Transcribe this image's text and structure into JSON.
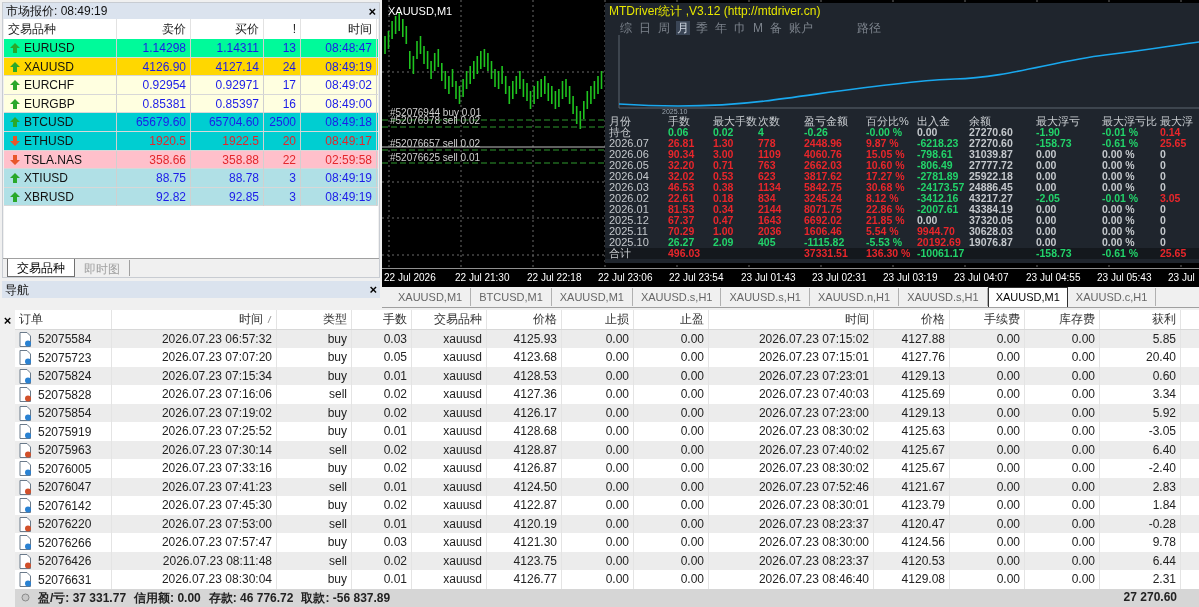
{
  "market_watch": {
    "title": "市场报价: 08:49:19",
    "close": "×",
    "columns": [
      "交易品种",
      "卖价",
      "买价",
      "!",
      "时间"
    ],
    "rows": [
      {
        "symbol": "EURUSD",
        "bid": "1.14298",
        "ask": "1.14311",
        "spread": "13",
        "time": "08:48:47",
        "rising": true,
        "color": "#00fa9a"
      },
      {
        "symbol": "XAUUSD",
        "bid": "4126.90",
        "ask": "4127.14",
        "spread": "24",
        "time": "08:49:19",
        "rising": true,
        "color": "#ffd700"
      },
      {
        "symbol": "EURCHF",
        "bid": "0.92954",
        "ask": "0.92971",
        "spread": "17",
        "time": "08:49:02",
        "rising": true,
        "color": "#ffffe0"
      },
      {
        "symbol": "EURGBP",
        "bid": "0.85381",
        "ask": "0.85397",
        "spread": "16",
        "time": "08:49:00",
        "rising": true,
        "color": "#ffffe0"
      },
      {
        "symbol": "BTCUSD",
        "bid": "65679.60",
        "ask": "65704.60",
        "spread": "2500",
        "time": "08:49:18",
        "rising": true,
        "color": "#00ced1"
      },
      {
        "symbol": "ETHUSD",
        "bid": "1920.5",
        "ask": "1922.5",
        "spread": "20",
        "time": "08:49:17",
        "rising": false,
        "color": "#00ced1"
      },
      {
        "symbol": "TSLA.NAS",
        "bid": "358.66",
        "ask": "358.88",
        "spread": "22",
        "time": "02:59:58",
        "rising": false,
        "color": "#ffc0cb"
      },
      {
        "symbol": "XTIUSD",
        "bid": "88.75",
        "ask": "88.78",
        "spread": "3",
        "time": "08:49:19",
        "rising": true,
        "color": "#b0e0e6"
      },
      {
        "symbol": "XBRUSD",
        "bid": "92.82",
        "ask": "92.85",
        "spread": "3",
        "time": "08:49:19",
        "rising": true,
        "color": "#b0e0e6"
      }
    ],
    "tabs": [
      {
        "label": "交易品种",
        "selected": true
      },
      {
        "label": "即时图",
        "selected": false
      }
    ]
  },
  "navigator": {
    "title": "导航",
    "close": "×"
  },
  "chart": {
    "title": "XAUUSD,M1",
    "orders": [
      "#52076944 buy 0.01",
      "#52076978 sell 0.02",
      "#52076657 sell 0.02",
      "#52076625 sell 0.01"
    ],
    "time_axis": [
      "22 Jul 2026",
      "22 Jul 21:30",
      "22 Jul 22:18",
      "22 Jul 23:06",
      "22 Jul 23:54",
      "23 Jul 01:43",
      "23 Jul 02:31",
      "23 Jul 03:19",
      "23 Jul 04:07",
      "23 Jul 04:55",
      "23 Jul 05:43",
      "23 Jul"
    ]
  },
  "stats_panel": {
    "title": "MTDriver统计 ,V3.12 (http://mtdriver.cn)",
    "menu": [
      {
        "label": "综",
        "selected": false
      },
      {
        "label": "日",
        "selected": false
      },
      {
        "label": "周",
        "selected": false
      },
      {
        "label": "月",
        "selected": true
      },
      {
        "label": "季",
        "selected": false
      },
      {
        "label": "年",
        "selected": false
      },
      {
        "label": "巾",
        "selected": false
      },
      {
        "label": "M",
        "selected": false
      },
      {
        "label": "备",
        "selected": false
      },
      {
        "label": "账户",
        "selected": false
      }
    ],
    "path_button": "路径",
    "curve_label": "2025.10",
    "columns": [
      "月份",
      "手数",
      "最大手数",
      "次数",
      "盈亏金额",
      "百分比%",
      "出入金",
      "余额",
      "最大浮亏",
      "最大浮亏比",
      "最大浮"
    ],
    "rows": [
      {
        "kind": "period",
        "label": "持仓",
        "lots": {
          "text": "0.06",
          "color": "#22d36a"
        },
        "max_lots": {
          "text": "0.02",
          "color": "#22d36a"
        },
        "count": {
          "text": "4",
          "color": "#22d36a"
        },
        "pnl": {
          "text": "-0.26",
          "color": "#22d36a"
        },
        "percent": {
          "text": "-0.00 %",
          "color": "#22d36a"
        },
        "cash_flow": {
          "text": "0.00",
          "color": "#c4c8cc"
        },
        "balance": {
          "text": "27270.60",
          "color": "#c4c8cc"
        },
        "max_float_loss": {
          "text": "-1.90",
          "color": "#22d36a"
        },
        "max_float_ratio": {
          "text": "-0.01 %",
          "color": "#22d36a"
        },
        "column_11": {
          "text": "0.14",
          "color": "#e8262b"
        }
      },
      {
        "kind": "period",
        "label": "2026.07",
        "lots": {
          "text": "26.81",
          "color": "#e8262b"
        },
        "max_lots": {
          "text": "1.30",
          "color": "#e8262b"
        },
        "count": {
          "text": "778",
          "color": "#e8262b"
        },
        "pnl": {
          "text": "2448.96",
          "color": "#e8262b"
        },
        "percent": {
          "text": "9.87 %",
          "color": "#e8262b"
        },
        "cash_flow": {
          "text": "-6218.23",
          "color": "#22d36a"
        },
        "balance": {
          "text": "27270.60",
          "color": "#c4c8cc"
        },
        "max_float_loss": {
          "text": "-158.73",
          "color": "#22d36a"
        },
        "max_float_ratio": {
          "text": "-0.61 %",
          "color": "#22d36a"
        },
        "column_11": {
          "text": "25.65",
          "color": "#e8262b"
        }
      },
      {
        "kind": "period",
        "label": "2026.06",
        "lots": {
          "text": "90.34",
          "color": "#e8262b"
        },
        "max_lots": {
          "text": "3.00",
          "color": "#e8262b"
        },
        "count": {
          "text": "1109",
          "color": "#e8262b"
        },
        "pnl": {
          "text": "4060.76",
          "color": "#e8262b"
        },
        "percent": {
          "text": "15.05 %",
          "color": "#e8262b"
        },
        "cash_flow": {
          "text": "-798.61",
          "color": "#22d36a"
        },
        "balance": {
          "text": "31039.87",
          "color": "#c4c8cc"
        },
        "max_float_loss": {
          "text": "0.00",
          "color": "#c4c8cc"
        },
        "max_float_ratio": {
          "text": "0.00 %",
          "color": "#c4c8cc"
        },
        "column_11": {
          "text": "0",
          "color": "#c4c8cc"
        }
      },
      {
        "kind": "period",
        "label": "2026.05",
        "lots": {
          "text": "32.20",
          "color": "#e8262b"
        },
        "max_lots": {
          "text": "0.71",
          "color": "#e8262b"
        },
        "count": {
          "text": "763",
          "color": "#e8262b"
        },
        "pnl": {
          "text": "2662.03",
          "color": "#e8262b"
        },
        "percent": {
          "text": "10.60 %",
          "color": "#e8262b"
        },
        "cash_flow": {
          "text": "-806.49",
          "color": "#22d36a"
        },
        "balance": {
          "text": "27777.72",
          "color": "#c4c8cc"
        },
        "max_float_loss": {
          "text": "0.00",
          "color": "#c4c8cc"
        },
        "max_float_ratio": {
          "text": "0.00 %",
          "color": "#c4c8cc"
        },
        "column_11": {
          "text": "0",
          "color": "#c4c8cc"
        }
      },
      {
        "kind": "period",
        "label": "2026.04",
        "lots": {
          "text": "32.02",
          "color": "#e8262b"
        },
        "max_lots": {
          "text": "0.53",
          "color": "#e8262b"
        },
        "count": {
          "text": "623",
          "color": "#e8262b"
        },
        "pnl": {
          "text": "3817.62",
          "color": "#e8262b"
        },
        "percent": {
          "text": "17.27 %",
          "color": "#e8262b"
        },
        "cash_flow": {
          "text": "-2781.89",
          "color": "#22d36a"
        },
        "balance": {
          "text": "25922.18",
          "color": "#c4c8cc"
        },
        "max_float_loss": {
          "text": "0.00",
          "color": "#c4c8cc"
        },
        "max_float_ratio": {
          "text": "0.00 %",
          "color": "#c4c8cc"
        },
        "column_11": {
          "text": "0",
          "color": "#c4c8cc"
        }
      },
      {
        "kind": "period",
        "label": "2026.03",
        "lots": {
          "text": "46.53",
          "color": "#e8262b"
        },
        "max_lots": {
          "text": "0.38",
          "color": "#e8262b"
        },
        "count": {
          "text": "1134",
          "color": "#e8262b"
        },
        "pnl": {
          "text": "5842.75",
          "color": "#e8262b"
        },
        "percent": {
          "text": "30.68 %",
          "color": "#e8262b"
        },
        "cash_flow": {
          "text": "-24173.57",
          "color": "#22d36a"
        },
        "balance": {
          "text": "24886.45",
          "color": "#c4c8cc"
        },
        "max_float_loss": {
          "text": "0.00",
          "color": "#c4c8cc"
        },
        "max_float_ratio": {
          "text": "0.00 %",
          "color": "#c4c8cc"
        },
        "column_11": {
          "text": "0",
          "color": "#c4c8cc"
        }
      },
      {
        "kind": "period",
        "label": "2026.02",
        "lots": {
          "text": "22.61",
          "color": "#e8262b"
        },
        "max_lots": {
          "text": "0.18",
          "color": "#e8262b"
        },
        "count": {
          "text": "834",
          "color": "#e8262b"
        },
        "pnl": {
          "text": "3245.24",
          "color": "#e8262b"
        },
        "percent": {
          "text": "8.12 %",
          "color": "#e8262b"
        },
        "cash_flow": {
          "text": "-3412.16",
          "color": "#22d36a"
        },
        "balance": {
          "text": "43217.27",
          "color": "#c4c8cc"
        },
        "max_float_loss": {
          "text": "-2.05",
          "color": "#22d36a"
        },
        "max_float_ratio": {
          "text": "-0.01 %",
          "color": "#22d36a"
        },
        "column_11": {
          "text": "3.05",
          "color": "#e8262b"
        }
      },
      {
        "kind": "period",
        "label": "2026.01",
        "lots": {
          "text": "81.53",
          "color": "#e8262b"
        },
        "max_lots": {
          "text": "0.34",
          "color": "#e8262b"
        },
        "count": {
          "text": "2144",
          "color": "#e8262b"
        },
        "pnl": {
          "text": "8071.75",
          "color": "#e8262b"
        },
        "percent": {
          "text": "22.86 %",
          "color": "#e8262b"
        },
        "cash_flow": {
          "text": "-2007.61",
          "color": "#22d36a"
        },
        "balance": {
          "text": "43384.19",
          "color": "#c4c8cc"
        },
        "max_float_loss": {
          "text": "0.00",
          "color": "#c4c8cc"
        },
        "max_float_ratio": {
          "text": "0.00 %",
          "color": "#c4c8cc"
        },
        "column_11": {
          "text": "0",
          "color": "#c4c8cc"
        }
      },
      {
        "kind": "period",
        "label": "2025.12",
        "lots": {
          "text": "67.37",
          "color": "#e8262b"
        },
        "max_lots": {
          "text": "0.47",
          "color": "#e8262b"
        },
        "count": {
          "text": "1643",
          "color": "#e8262b"
        },
        "pnl": {
          "text": "6692.02",
          "color": "#e8262b"
        },
        "percent": {
          "text": "21.85 %",
          "color": "#e8262b"
        },
        "cash_flow": {
          "text": "0.00",
          "color": "#c4c8cc"
        },
        "balance": {
          "text": "37320.05",
          "color": "#c4c8cc"
        },
        "max_float_loss": {
          "text": "0.00",
          "color": "#c4c8cc"
        },
        "max_float_ratio": {
          "text": "0.00 %",
          "color": "#c4c8cc"
        },
        "column_11": {
          "text": "0",
          "color": "#c4c8cc"
        }
      },
      {
        "kind": "period",
        "label": "2025.11",
        "lots": {
          "text": "70.29",
          "color": "#e8262b"
        },
        "max_lots": {
          "text": "1.00",
          "color": "#e8262b"
        },
        "count": {
          "text": "2036",
          "color": "#e8262b"
        },
        "pnl": {
          "text": "1606.46",
          "color": "#e8262b"
        },
        "percent": {
          "text": "5.54 %",
          "color": "#e8262b"
        },
        "cash_flow": {
          "text": "9944.70",
          "color": "#e8262b"
        },
        "balance": {
          "text": "30628.03",
          "color": "#c4c8cc"
        },
        "max_float_loss": {
          "text": "0.00",
          "color": "#c4c8cc"
        },
        "max_float_ratio": {
          "text": "0.00 %",
          "color": "#c4c8cc"
        },
        "column_11": {
          "text": "0",
          "color": "#c4c8cc"
        }
      },
      {
        "kind": "period",
        "label": "2025.10",
        "lots": {
          "text": "26.27",
          "color": "#22d36a"
        },
        "max_lots": {
          "text": "2.09",
          "color": "#22d36a"
        },
        "count": {
          "text": "405",
          "color": "#22d36a"
        },
        "pnl": {
          "text": "-1115.82",
          "color": "#22d36a"
        },
        "percent": {
          "text": "-5.53 %",
          "color": "#22d36a"
        },
        "cash_flow": {
          "text": "20192.69",
          "color": "#e8262b"
        },
        "balance": {
          "text": "19076.87",
          "color": "#c4c8cc"
        },
        "max_float_loss": {
          "text": "0.00",
          "color": "#c4c8cc"
        },
        "max_float_ratio": {
          "text": "0.00 %",
          "color": "#c4c8cc"
        },
        "column_11": {
          "text": "0",
          "color": "#c4c8cc"
        }
      },
      {
        "kind": "total",
        "label": "合计",
        "lots": {
          "text": "496.03",
          "color": "#e8262b"
        },
        "pnl": {
          "text": "37331.51",
          "color": "#e8262b"
        },
        "percent": {
          "text": "136.30 %",
          "color": "#e8262b"
        },
        "cash_flow": {
          "text": "-10061.17",
          "color": "#22d36a"
        },
        "max_float_loss": {
          "text": "-158.73",
          "color": "#22d36a"
        },
        "max_float_ratio": {
          "text": "-0.61 %",
          "color": "#22d36a"
        },
        "column_11": {
          "text": "25.65",
          "color": "#e8262b"
        }
      }
    ]
  },
  "chart_tabs": [
    {
      "label": "XAUUSD,M1",
      "selected": false
    },
    {
      "label": "BTCUSD,M1",
      "selected": false
    },
    {
      "label": "XAUUSD,M1",
      "selected": false
    },
    {
      "label": "XAUUSD.s,H1",
      "selected": false
    },
    {
      "label": "XAUUSD.s,H1",
      "selected": false
    },
    {
      "label": "XAUUSD.n,H1",
      "selected": false
    },
    {
      "label": "XAUUSD.s,H1",
      "selected": false
    },
    {
      "label": "XAUUSD,M1",
      "selected": true
    },
    {
      "label": "XAUUSD.c,H1",
      "selected": false
    }
  ],
  "trades": {
    "close": "×",
    "columns": [
      "订单",
      "时间",
      "类型",
      "手数",
      "交易品种",
      "价格",
      "止损",
      "止盈",
      "时间",
      "价格",
      "手续费",
      "库存费",
      "获利"
    ],
    "rows": [
      {
        "kind": "buy",
        "cells": [
          "52075584",
          "2026.07.23 06:57:32",
          "buy",
          "0.03",
          "xauusd",
          "4125.93",
          "0.00",
          "0.00",
          "2026.07.23 07:15:02",
          "4127.88",
          "0.00",
          "0.00",
          "5.85"
        ]
      },
      {
        "kind": "buy",
        "cells": [
          "52075723",
          "2026.07.23 07:07:20",
          "buy",
          "0.05",
          "xauusd",
          "4123.68",
          "0.00",
          "0.00",
          "2026.07.23 07:15:01",
          "4127.76",
          "0.00",
          "0.00",
          "20.40"
        ]
      },
      {
        "kind": "buy",
        "cells": [
          "52075824",
          "2026.07.23 07:15:34",
          "buy",
          "0.01",
          "xauusd",
          "4128.53",
          "0.00",
          "0.00",
          "2026.07.23 07:23:01",
          "4129.13",
          "0.00",
          "0.00",
          "0.60"
        ]
      },
      {
        "kind": "sell",
        "cells": [
          "52075828",
          "2026.07.23 07:16:06",
          "sell",
          "0.02",
          "xauusd",
          "4127.36",
          "0.00",
          "0.00",
          "2026.07.23 07:40:03",
          "4125.69",
          "0.00",
          "0.00",
          "3.34"
        ]
      },
      {
        "kind": "buy",
        "cells": [
          "52075854",
          "2026.07.23 07:19:02",
          "buy",
          "0.02",
          "xauusd",
          "4126.17",
          "0.00",
          "0.00",
          "2026.07.23 07:23:00",
          "4129.13",
          "0.00",
          "0.00",
          "5.92"
        ]
      },
      {
        "kind": "buy",
        "cells": [
          "52075919",
          "2026.07.23 07:25:52",
          "buy",
          "0.01",
          "xauusd",
          "4128.68",
          "0.00",
          "0.00",
          "2026.07.23 08:30:02",
          "4125.63",
          "0.00",
          "0.00",
          "-3.05"
        ]
      },
      {
        "kind": "sell",
        "cells": [
          "52075963",
          "2026.07.23 07:30:14",
          "sell",
          "0.02",
          "xauusd",
          "4128.87",
          "0.00",
          "0.00",
          "2026.07.23 07:40:02",
          "4125.67",
          "0.00",
          "0.00",
          "6.40"
        ]
      },
      {
        "kind": "buy",
        "cells": [
          "52076005",
          "2026.07.23 07:33:16",
          "buy",
          "0.02",
          "xauusd",
          "4126.87",
          "0.00",
          "0.00",
          "2026.07.23 08:30:02",
          "4125.67",
          "0.00",
          "0.00",
          "-2.40"
        ]
      },
      {
        "kind": "sell",
        "cells": [
          "52076047",
          "2026.07.23 07:41:23",
          "sell",
          "0.01",
          "xauusd",
          "4124.50",
          "0.00",
          "0.00",
          "2026.07.23 07:52:46",
          "4121.67",
          "0.00",
          "0.00",
          "2.83"
        ]
      },
      {
        "kind": "buy",
        "cells": [
          "52076142",
          "2026.07.23 07:45:30",
          "buy",
          "0.02",
          "xauusd",
          "4122.87",
          "0.00",
          "0.00",
          "2026.07.23 08:30:01",
          "4123.79",
          "0.00",
          "0.00",
          "1.84"
        ]
      },
      {
        "kind": "sell",
        "cells": [
          "52076220",
          "2026.07.23 07:53:00",
          "sell",
          "0.01",
          "xauusd",
          "4120.19",
          "0.00",
          "0.00",
          "2026.07.23 08:23:37",
          "4120.47",
          "0.00",
          "0.00",
          "-0.28"
        ]
      },
      {
        "kind": "buy",
        "cells": [
          "52076266",
          "2026.07.23 07:57:47",
          "buy",
          "0.03",
          "xauusd",
          "4121.30",
          "0.00",
          "0.00",
          "2026.07.23 08:30:00",
          "4124.56",
          "0.00",
          "0.00",
          "9.78"
        ]
      },
      {
        "kind": "sell",
        "cells": [
          "52076426",
          "2026.07.23 08:11:48",
          "sell",
          "0.02",
          "xauusd",
          "4123.75",
          "0.00",
          "0.00",
          "2026.07.23 08:23:37",
          "4120.53",
          "0.00",
          "0.00",
          "6.44"
        ]
      },
      {
        "kind": "buy",
        "cells": [
          "52076631",
          "2026.07.23 08:30:04",
          "buy",
          "0.01",
          "xauusd",
          "4126.77",
          "0.00",
          "0.00",
          "2026.07.23 08:46:40",
          "4129.08",
          "0.00",
          "0.00",
          "2.31"
        ]
      }
    ],
    "summary": [
      "盈/亏: 37 331.77",
      "信用额: 0.00",
      "存款: 46 776.72",
      "取款: -56 837.89"
    ],
    "profit_total": "27 270.60"
  }
}
